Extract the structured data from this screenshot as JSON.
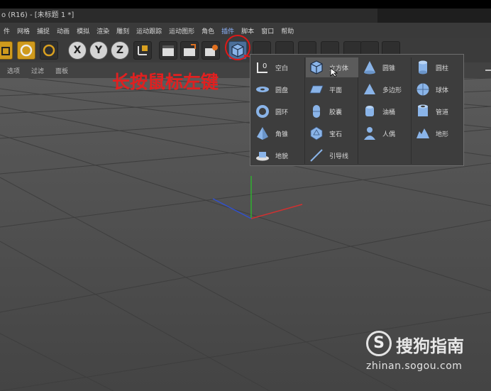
{
  "window": {
    "title": "o (R16) - [未标题 1 *]"
  },
  "menu": [
    "件",
    "网格",
    "捕捉",
    "动画",
    "模拟",
    "渲染",
    "雕刻",
    "运动跟踪",
    "运动图形",
    "角色",
    "插件",
    "脚本",
    "窗口",
    "帮助"
  ],
  "toolbar": {
    "x_label": "X",
    "y_label": "Y",
    "z_label": "Z"
  },
  "subbar": [
    "选项",
    "过滤",
    "面板"
  ],
  "annotation": "长按鼠标左键",
  "primitives": [
    {
      "label": "空白",
      "icon": "null-icon"
    },
    {
      "label": "立方体",
      "icon": "cube-icon"
    },
    {
      "label": "圆锥",
      "icon": "cone-icon"
    },
    {
      "label": "圆柱",
      "icon": "cylinder-icon"
    },
    {
      "label": "圆盘",
      "icon": "disc-icon"
    },
    {
      "label": "平面",
      "icon": "plane-icon"
    },
    {
      "label": "多边形",
      "icon": "polygon-icon"
    },
    {
      "label": "球体",
      "icon": "sphere-icon"
    },
    {
      "label": "圆环",
      "icon": "torus-icon"
    },
    {
      "label": "胶囊",
      "icon": "capsule-icon"
    },
    {
      "label": "油桶",
      "icon": "oiltank-icon"
    },
    {
      "label": "管道",
      "icon": "tube-icon"
    },
    {
      "label": "角锥",
      "icon": "pyramid-icon"
    },
    {
      "label": "宝石",
      "icon": "platonic-icon"
    },
    {
      "label": "人偶",
      "icon": "figure-icon"
    },
    {
      "label": "地形",
      "icon": "landscape-icon"
    },
    {
      "label": "地貌",
      "icon": "relief-icon"
    },
    {
      "label": "引导线",
      "icon": "guide-icon"
    }
  ],
  "watermark": {
    "logo": "S",
    "title": "搜狗指南",
    "url": "zhinan.sogou.com"
  },
  "colors": {
    "accent_red": "#e02020",
    "icon_blue": "#8ab4e8"
  }
}
